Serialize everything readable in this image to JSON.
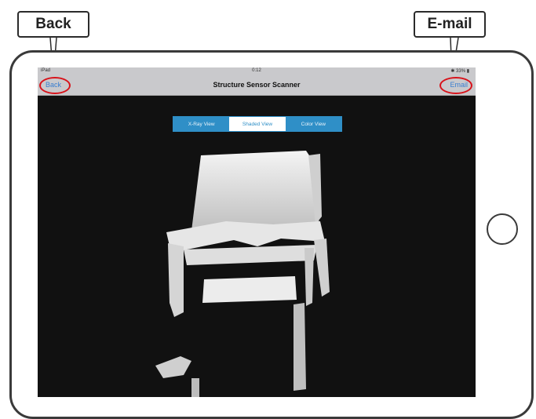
{
  "callouts": {
    "back": "Back",
    "email": "E-mail"
  },
  "status_bar": {
    "carrier": "iPad",
    "time": "0:12",
    "battery": "✱ 33% ▮"
  },
  "nav": {
    "back_label": "Back",
    "title": "Structure Sensor Scanner",
    "email_label": "Email"
  },
  "view_modes": {
    "options": [
      "X-Ray View",
      "Shaded View",
      "Color View"
    ],
    "selected": "Shaded View"
  },
  "colors": {
    "accent": "#2f8fc7",
    "highlight": "#d8121a",
    "screen": "#111111"
  }
}
